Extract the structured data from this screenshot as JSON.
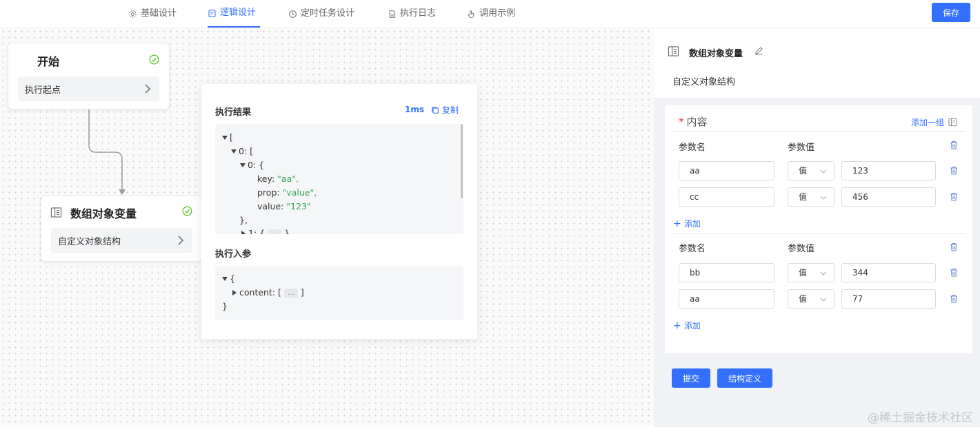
{
  "tabs": [
    {
      "label": "基础设计",
      "icon": "gear-icon"
    },
    {
      "label": "逻辑设计",
      "icon": "document-icon"
    },
    {
      "label": "定时任务设计",
      "icon": "clock-icon"
    },
    {
      "label": "执行日志",
      "icon": "file-icon"
    },
    {
      "label": "调用示例",
      "icon": "hand-pointer-icon"
    }
  ],
  "active_tab": "逻辑设计",
  "save_label": "保存",
  "nodes": {
    "start": {
      "title": "开始",
      "row": "执行起点",
      "status_icon": "check-circle-icon"
    },
    "array_var": {
      "title": "数组对象变量",
      "row": "自定义对象结构",
      "icon": "table-icon",
      "status_icon": "check-circle-icon"
    }
  },
  "popup": {
    "result_label": "执行结果",
    "time": "1ms",
    "copy_label": "复制",
    "input_label": "执行入参",
    "result_lines": {
      "l1": "[",
      "l2": "0: [",
      "l3": "0: {",
      "l4_key": "key: ",
      "l4_val": "\"aa\",",
      "l5_key": "prop: ",
      "l5_val": "\"value\",",
      "l6_key": "value: ",
      "l6_val": "\"123\"",
      "l7": "},",
      "l8": "1: {",
      "l8_end": "}"
    },
    "input_lines": {
      "l1": "{",
      "l2": "content: [",
      "l2_end": "]",
      "l3": "}"
    },
    "ellipsis": "…"
  },
  "panel": {
    "title": "数组对象变量",
    "subtitle": "自定义对象结构",
    "content_label": "内容",
    "required_mark": "*",
    "add_group_label": "添加一组",
    "groups": [
      {
        "name_header": "参数名",
        "value_header": "参数值",
        "rows": [
          {
            "name": "aa",
            "type": "值",
            "value": "123"
          },
          {
            "name": "cc",
            "type": "值",
            "value": "456"
          }
        ],
        "add_label": "添加"
      },
      {
        "name_header": "参数名",
        "value_header": "参数值",
        "rows": [
          {
            "name": "bb",
            "type": "值",
            "value": "344"
          },
          {
            "name": "aa",
            "type": "值",
            "value": "77"
          }
        ],
        "add_label": "添加"
      }
    ],
    "submit_label": "提交",
    "struct_label": "结构定义"
  },
  "watermark": "@稀土掘金技术社区",
  "colors": {
    "primary": "#3370ff",
    "success": "#52c41a",
    "string": "#31a354"
  }
}
